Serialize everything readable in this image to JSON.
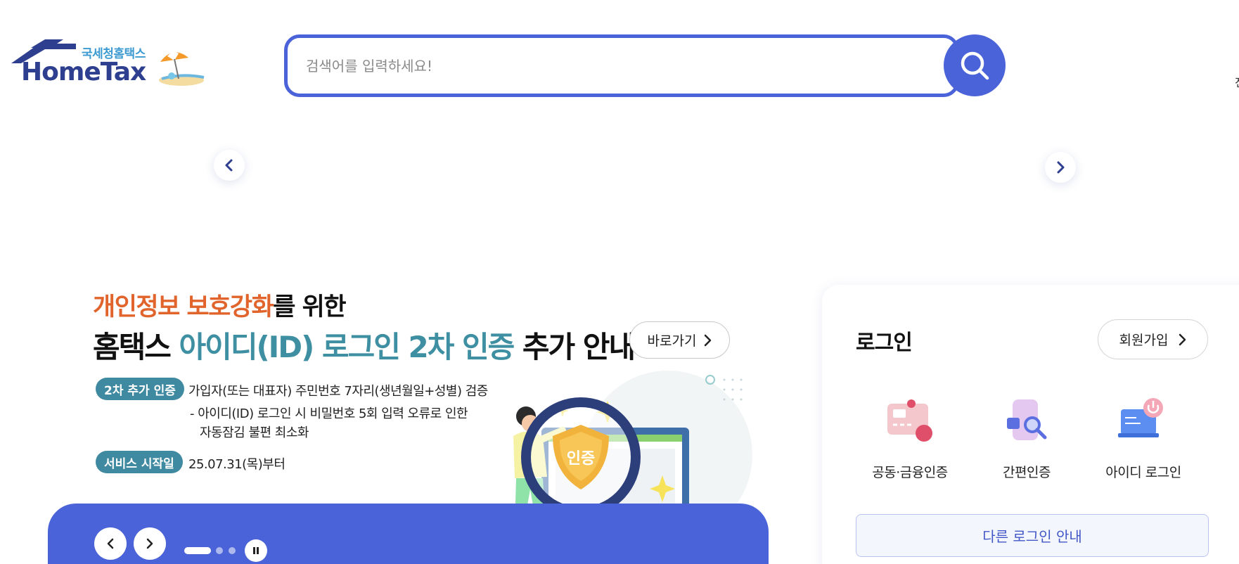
{
  "header": {
    "logo_sub": "국세청홈택스",
    "logo_main": "HomeTax",
    "search_placeholder": "검색어를 입력하세요!",
    "edge_char": "전"
  },
  "banner": {
    "headline1_orange": "개인정보 보호강화",
    "headline1_rest": "를 위한",
    "headline2_a": "홈택스 ",
    "headline2_teal": "아이디(ID) 로그인 2차 인증",
    "headline2_b": " 추가 안내",
    "go_label": "바로가기",
    "tag1": "2차 추가 인증",
    "line1": "가입자(또는 대표자) 주민번호 7자리(생년월일+성별) 검증",
    "line2": "- 아이디(ID) 로그인 시 비밀번호 5회 입력 오류로 인한",
    "line3": "자동잠김 불편 최소화",
    "tag2": "서비스 시작일",
    "start_date": "25.07.31(목)부터",
    "shield_text": "인증"
  },
  "login": {
    "title": "로그인",
    "signup_label": "회원가입",
    "options": [
      {
        "label": "공동·금융인증",
        "icon": "certificate-card-icon"
      },
      {
        "label": "간편인증",
        "icon": "simple-auth-phone-icon"
      },
      {
        "label": "아이디 로그인",
        "icon": "id-login-laptop-icon"
      }
    ],
    "other_label": "다른 로그인 안내"
  },
  "colors": {
    "primary": "#4a63d8",
    "orange": "#e0642b",
    "teal": "#3f8fa3",
    "logo_navy": "#2e3f8f"
  }
}
